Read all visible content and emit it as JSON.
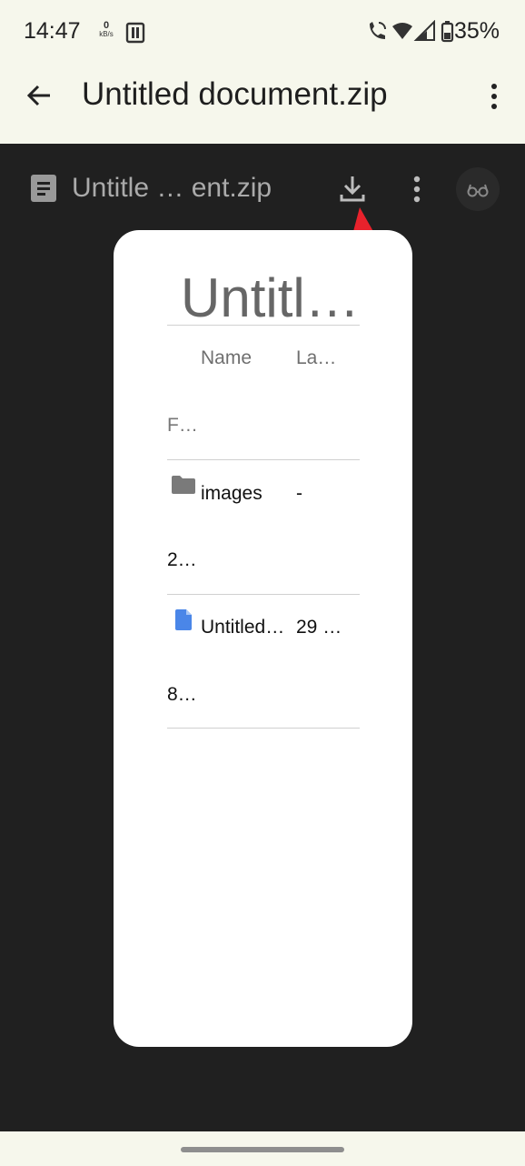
{
  "status_bar": {
    "time": "14:47",
    "net_speed_value": "0",
    "net_speed_unit": "kB/s",
    "battery": "35%"
  },
  "app_bar": {
    "title": "Untitled document.zip"
  },
  "viewer": {
    "file_name": "Untitle … ent.zip"
  },
  "document": {
    "title": "Untitl…",
    "headers": [
      "Name",
      "La…"
    ],
    "first_cell": "F…",
    "rows": [
      {
        "icon": "folder-icon",
        "name": "images",
        "modified": "-",
        "size": "2…"
      },
      {
        "icon": "google-doc-icon",
        "name": "Untitled…",
        "modified": "29 …",
        "size": "8…"
      }
    ]
  },
  "colors": {
    "annotation_arrow": "#e8222c",
    "viewer_background": "#202020",
    "system_bar": "#f6f7ec"
  }
}
